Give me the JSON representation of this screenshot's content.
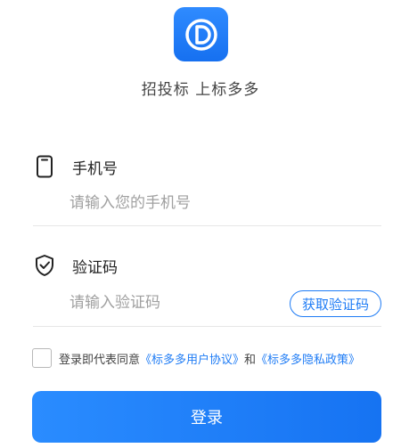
{
  "header": {
    "logo_icon": "app-logo-d-icon",
    "slogan": "招投标 上标多多"
  },
  "phone": {
    "icon": "phone-icon",
    "label": "手机号",
    "placeholder": "请输入您的手机号",
    "value": ""
  },
  "code": {
    "icon": "shield-check-icon",
    "label": "验证码",
    "placeholder": "请输入验证码",
    "value": "",
    "get_code_label": "获取验证码"
  },
  "agreement": {
    "checked": false,
    "prefix": "登录即代表同意",
    "user_agreement": "《标多多用户协议》",
    "and": "和",
    "privacy_policy": "《标多多隐私政策》"
  },
  "login": {
    "label": "登录"
  },
  "colors": {
    "accent": "#1f7cf5",
    "button_gradient_start": "#2a8cff",
    "button_gradient_end": "#1673f2"
  }
}
